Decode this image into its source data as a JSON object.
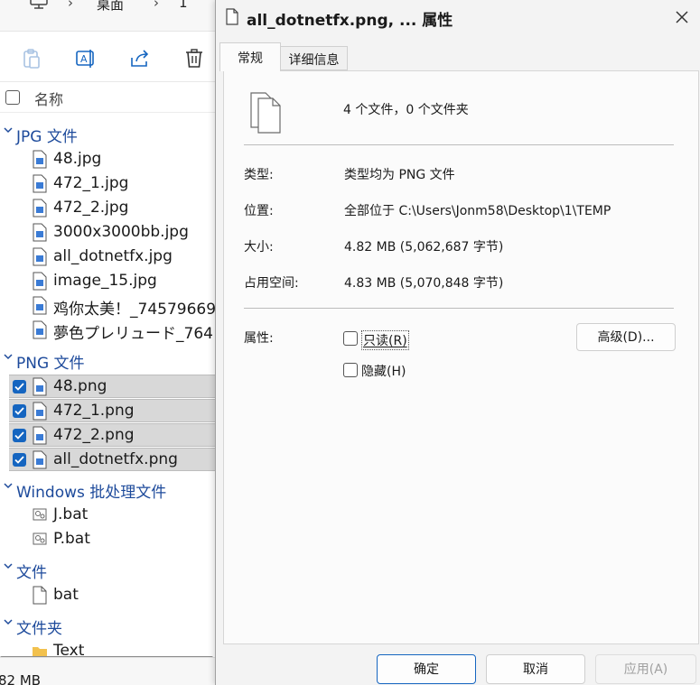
{
  "explorer": {
    "breadcrumb": [
      "桌面",
      "1"
    ],
    "column_header": "名称",
    "groups": [
      {
        "label": "JPG 文件",
        "top": 0,
        "files": [
          "48.jpg",
          "472_1.jpg",
          "472_2.jpg",
          "3000x3000bb.jpg",
          "all_dotnetfx.jpg",
          "image_15.jpg",
          "鸡你太美！_74579669",
          "夢色プレリュード_764"
        ]
      },
      {
        "label": "PNG 文件",
        "files": [
          "48.png",
          "472_1.png",
          "472_2.png",
          "all_dotnetfx.png"
        ]
      },
      {
        "label": "Windows 批处理文件",
        "files": [
          "J.bat",
          "P.bat"
        ]
      },
      {
        "label": "文件",
        "files": [
          "bat"
        ]
      },
      {
        "label": "文件夹",
        "files": [
          "Text"
        ]
      }
    ],
    "status": "82 MB"
  },
  "dialog": {
    "title": "all_dotnetfx.png, ... 属性",
    "tabs": [
      "常规",
      "详细信息"
    ],
    "summary": "4 个文件，0 个文件夹",
    "type_label": "类型:",
    "type_value": "类型均为 PNG 文件",
    "location_label": "位置:",
    "location_value": "全部位于 C:\\Users\\Jonm58\\Desktop\\1\\TEMP",
    "size_label": "大小:",
    "size_value": "4.82 MB (5,062,687 字节)",
    "disk_label": "占用空间:",
    "disk_value": "4.83 MB (5,070,848 字节)",
    "attributes_label": "属性:",
    "readonly_label": "只读(R)",
    "hidden_label": "隐藏(H)",
    "advanced_button": "高级(D)...",
    "ok_button": "确定",
    "cancel_button": "取消",
    "apply_button": "应用(A)"
  }
}
